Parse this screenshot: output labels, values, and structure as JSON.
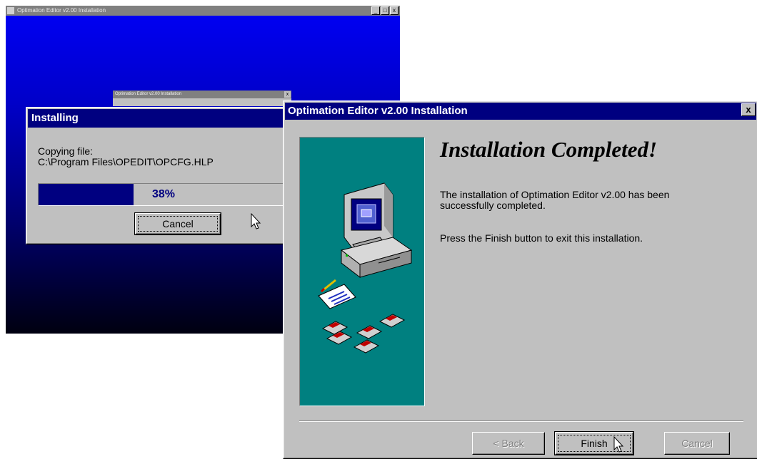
{
  "background_window": {
    "title": "Optimation Editor v2.00 Installation",
    "controls": [
      "_",
      "□",
      "x"
    ]
  },
  "collapsed_window": {
    "title": "Optimation Editor v2.00 Installation",
    "close": "x"
  },
  "installing_dialog": {
    "title": "Installing",
    "copying_label": "Copying file:",
    "file_path": "C:\\Program Files\\OPEDIT\\OPCFG.HLP",
    "progress_percent": 38,
    "progress_text": "38%",
    "cancel_label": "Cancel"
  },
  "main_dialog": {
    "title": "Optimation Editor v2.00 Installation",
    "close": "x",
    "heading": "Installation Completed!",
    "message_1": "The installation of Optimation Editor v2.00 has been successfully completed.",
    "message_2": "Press the Finish button to exit this installation.",
    "back_label": "< Back",
    "back_accel": "B",
    "finish_label": "Finish",
    "cancel_label": "Cancel",
    "panel_color": "#008080",
    "title_color": "#000080"
  },
  "icons": [
    "computer-icon",
    "floppy-disk-icon",
    "document-icon",
    "mouse-cursor-icon"
  ]
}
